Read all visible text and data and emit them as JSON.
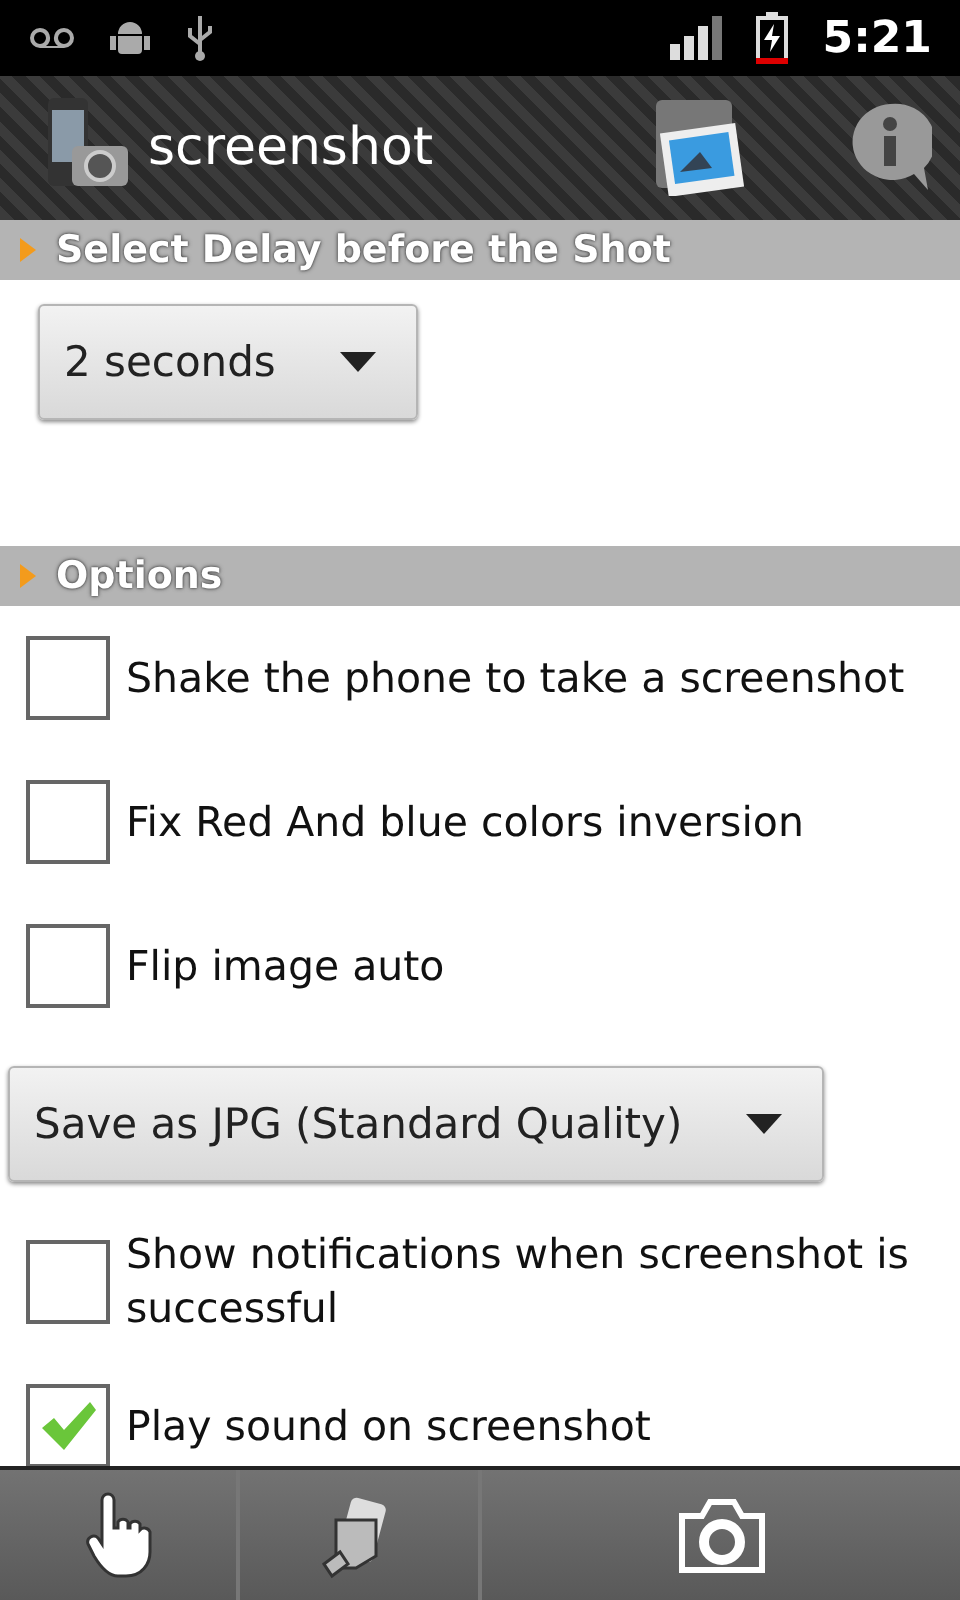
{
  "status_bar": {
    "time": "5:21"
  },
  "title_bar": {
    "title": "screenshot"
  },
  "items": [
    {
      "kind": "header",
      "label": "Select Delay before the Shot"
    },
    {
      "kind": "delay-dropdown",
      "value": "2 seconds"
    },
    {
      "kind": "header",
      "label": "Options"
    },
    {
      "kind": "checkbox",
      "label": "Shake the phone to take a screenshot",
      "checked": false
    },
    {
      "kind": "checkbox",
      "label": "Fix Red And blue colors inversion",
      "checked": false
    },
    {
      "kind": "checkbox",
      "label": "Flip image auto",
      "checked": false
    },
    {
      "kind": "dropdown",
      "value": "Save as JPG (Standard Quality)"
    },
    {
      "kind": "checkbox",
      "label": "Show notifications when screenshot is successful",
      "checked": false
    },
    {
      "kind": "checkbox",
      "label": "Play sound on screenshot",
      "checked": true
    }
  ]
}
